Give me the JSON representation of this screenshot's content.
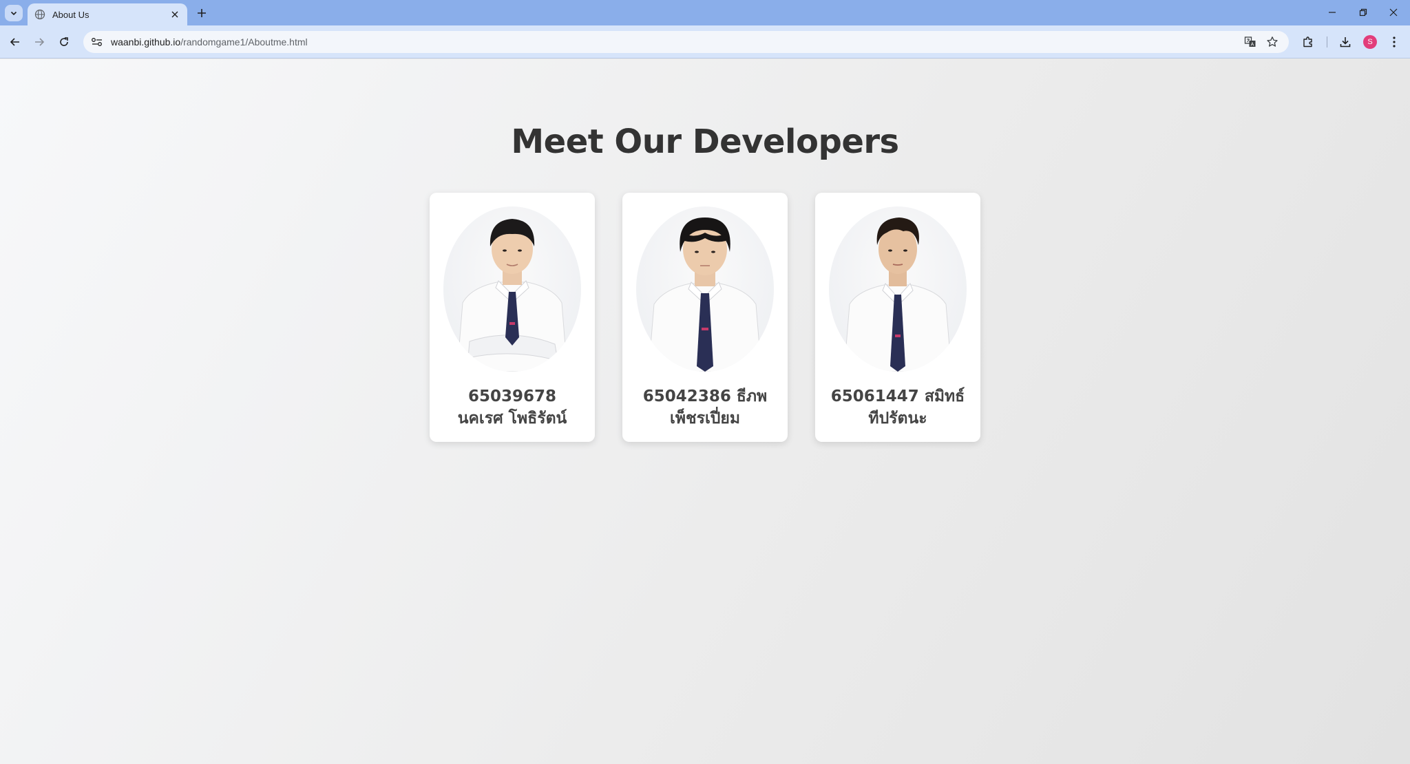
{
  "browser": {
    "tab_title": "About Us",
    "url_host": "waanbi.github.io",
    "url_path": "/randomgame1/Aboutme.html",
    "profile_initial": "S",
    "profile_color": "#e23d7a",
    "chrome_color": "#8aaeea"
  },
  "page": {
    "title": "Meet Our Developers",
    "developers": [
      {
        "name": "65039678 นคเรศ โพธิรัตน์",
        "photo_icon": "developer-photo"
      },
      {
        "name": "65042386 ธีภพ เพ็ชรเปี่ยม",
        "photo_icon": "developer-photo"
      },
      {
        "name": "65061447 สมิทธ์ ทีปรัตนะ",
        "photo_icon": "developer-photo"
      }
    ],
    "tie_color": "#2a2f55",
    "shirt_color": "#ffffff"
  }
}
